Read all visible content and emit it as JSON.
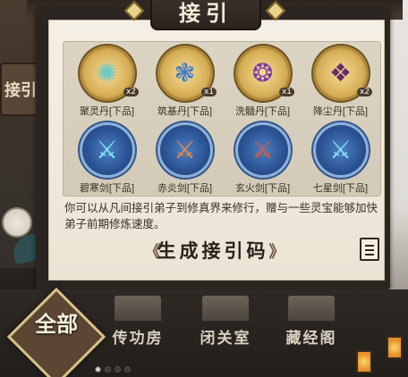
{
  "window": {
    "title": "接引"
  },
  "background": {
    "sign_text": "接引"
  },
  "items": [
    {
      "name": "聚灵丹[下品]",
      "count": "x2",
      "style": "gold",
      "glyph": "✺",
      "glyph_color": "#6fc7c9"
    },
    {
      "name": "筑基丹[下品]",
      "count": "x1",
      "style": "gold",
      "glyph": "❃",
      "glyph_color": "#3b78c9"
    },
    {
      "name": "洗髓丹[下品]",
      "count": "x1",
      "style": "gold",
      "glyph": "❂",
      "glyph_color": "#7b3aa8"
    },
    {
      "name": "降尘丹[下品]",
      "count": "x2",
      "style": "gold",
      "glyph": "❖",
      "glyph_color": "#6a2c6a"
    },
    {
      "name": "碧寒剑[下品]",
      "count": "",
      "style": "blue",
      "glyph": "⚔",
      "glyph_color": "#7fe8f5"
    },
    {
      "name": "赤炎剑[下品]",
      "count": "",
      "style": "blue",
      "glyph": "⚔",
      "glyph_color": "#f08a3a"
    },
    {
      "name": "玄火剑[下品]",
      "count": "",
      "style": "blue",
      "glyph": "⚔",
      "glyph_color": "#e8542f"
    },
    {
      "name": "七星剑[下品]",
      "count": "",
      "style": "blue",
      "glyph": "⚔",
      "glyph_color": "#8be3ff"
    }
  ],
  "description": "你可以从凡间接引弟子到修真界来修行，赠与一些灵宝能够加快弟子前期修炼速度。",
  "generate_button": {
    "label": "生成接引码",
    "left_chevron": "《",
    "right_chevron": "》"
  },
  "nav": {
    "all": "全部",
    "tabs": [
      "传功房",
      "闭关室",
      "藏经阁"
    ]
  },
  "colors": {
    "paper": "#f4efe4",
    "frame": "#2b2522",
    "accent_gold": "#b08a3a"
  }
}
